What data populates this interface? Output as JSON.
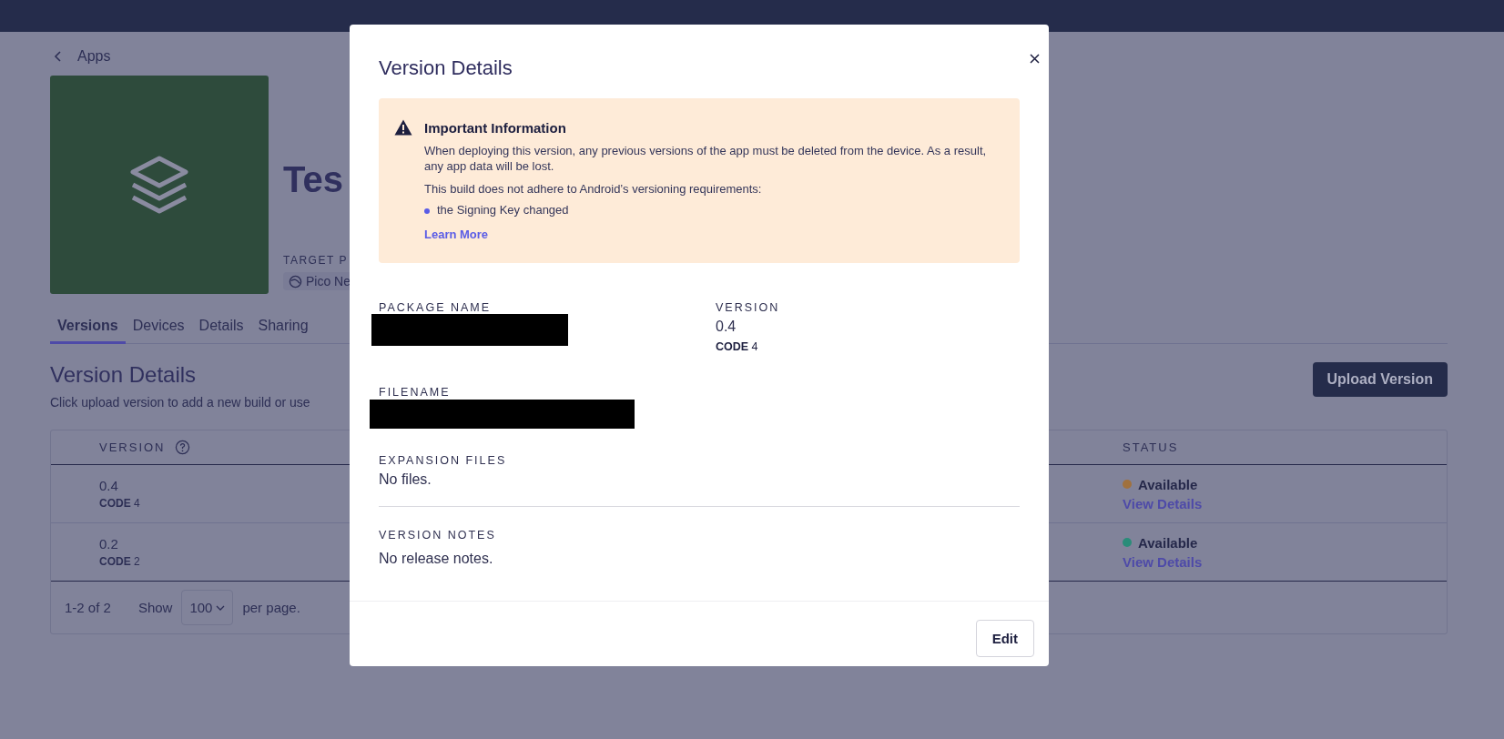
{
  "breadcrumb": {
    "label": "Apps"
  },
  "app": {
    "title": "Tes",
    "target_label": "TARGET P",
    "platform": "Pico Ne"
  },
  "tabs": [
    {
      "label": "Versions",
      "selected": true
    },
    {
      "label": "Devices",
      "selected": false
    },
    {
      "label": "Details",
      "selected": false
    },
    {
      "label": "Sharing",
      "selected": false
    }
  ],
  "section": {
    "title": "Version Details",
    "description": "Click upload version to add a new build or use",
    "upload_button": "Upload Version"
  },
  "table": {
    "columns": [
      "VERSION",
      "STATUS"
    ],
    "rows": [
      {
        "version": "0.4",
        "code_label": "CODE",
        "code": "4",
        "status": "Available",
        "color": "#a0713e",
        "link": "View Details"
      },
      {
        "version": "0.2",
        "code_label": "CODE",
        "code": "2",
        "status": "Available",
        "color": "#2a8c79",
        "link": "View Details"
      }
    ]
  },
  "pagination": {
    "range": "1-2 of 2",
    "show_label": "Show",
    "per_page": "100",
    "suffix": "per page."
  },
  "modal": {
    "title": "Version Details",
    "alert": {
      "title": "Important Information",
      "paragraphs": [
        "When deploying this version, any previous versions of the app must be deleted from the device. As a result, any app data will be lost.",
        "This build does not adhere to Android’s versioning requirements:"
      ],
      "bullets": [
        "the Signing Key changed"
      ],
      "link": "Learn More"
    },
    "package_label": "PACKAGE NAME",
    "version_label": "VERSION",
    "version": "0.4",
    "code_label": "CODE",
    "code": "4",
    "filename_label": "FILENAME",
    "expansion_label": "EXPANSION FILES",
    "expansion_value": "No files.",
    "notes_label": "VERSION NOTES",
    "notes_value": "No release notes.",
    "edit_button": "Edit"
  }
}
